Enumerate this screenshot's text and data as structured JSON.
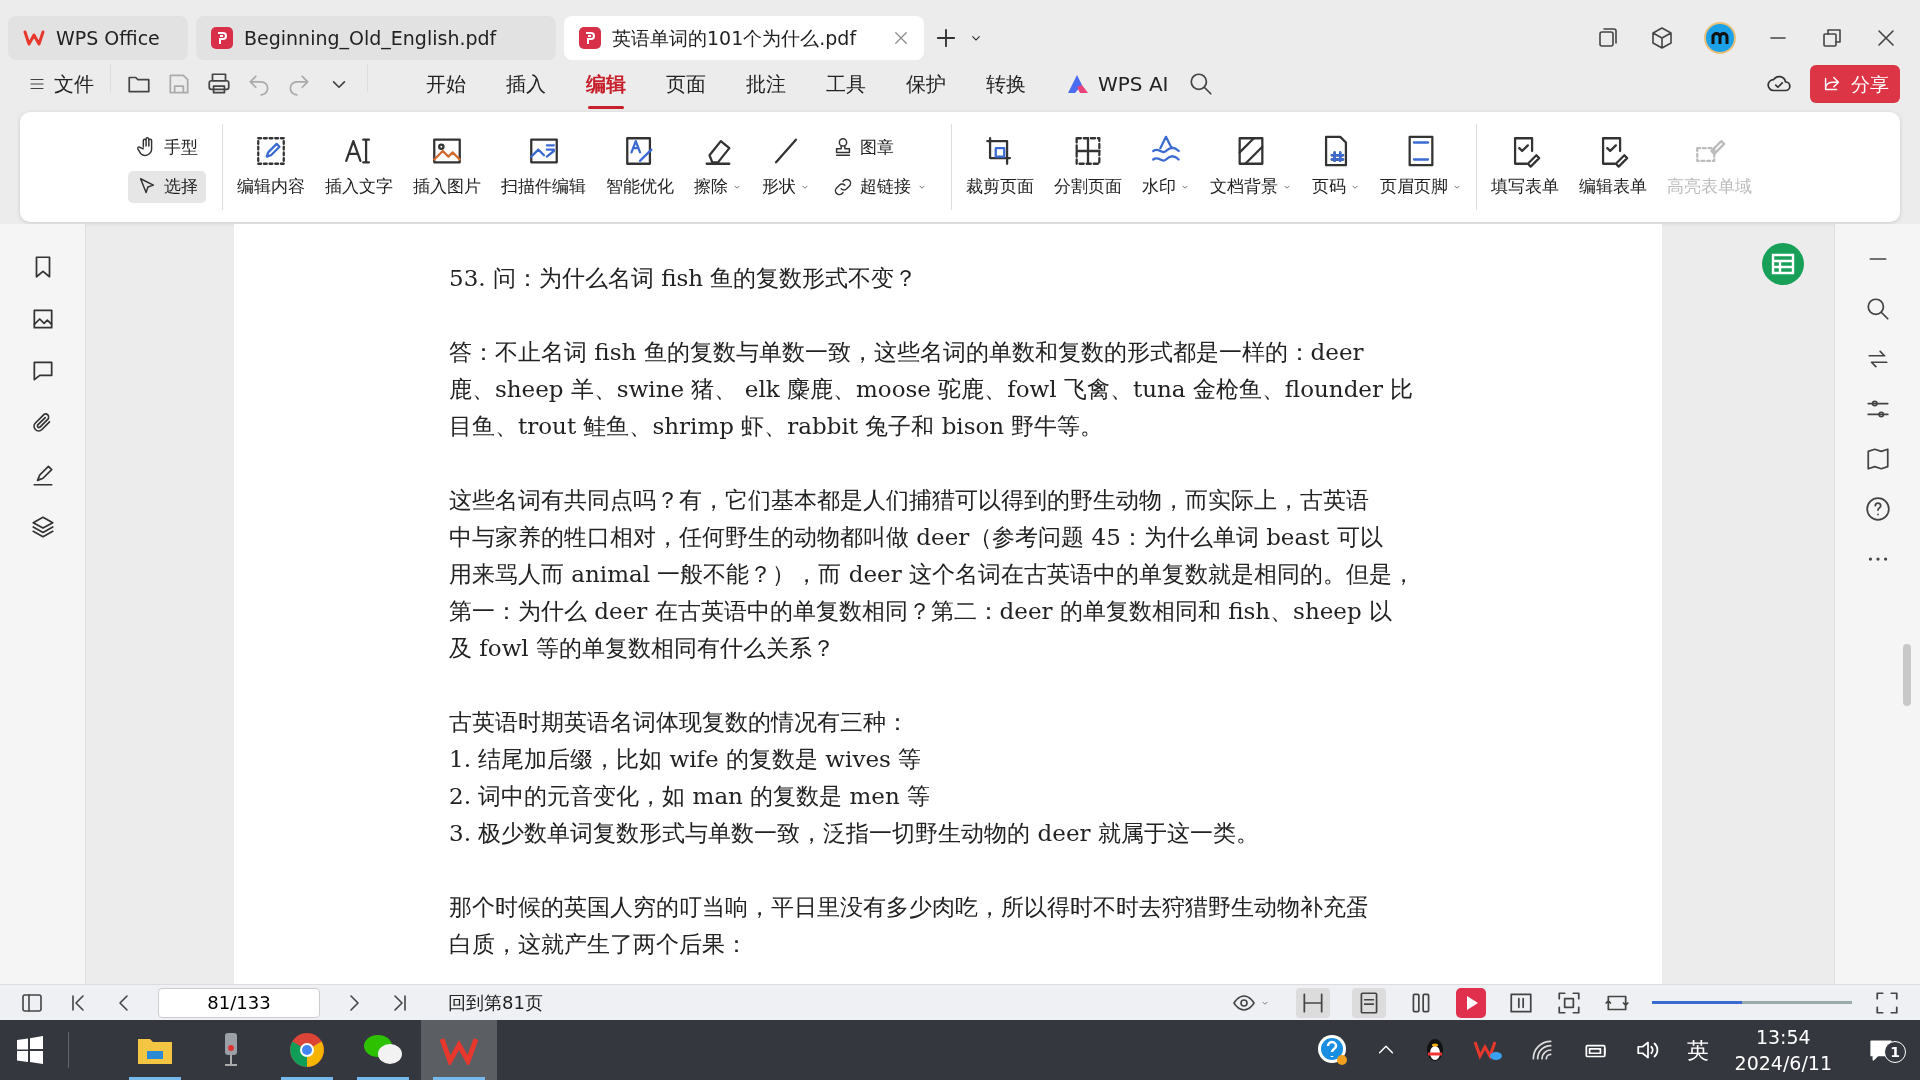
{
  "tabs": [
    {
      "label": "WPS Office",
      "kind": "home",
      "selected": false
    },
    {
      "label": "Beginning_Old_English.pdf",
      "kind": "pdf",
      "selected": false
    },
    {
      "label": "英语单词的101个为什么.pdf",
      "kind": "pdf",
      "selected": true
    }
  ],
  "menu": {
    "file": "文件",
    "items": [
      {
        "label": "开始",
        "selected": false
      },
      {
        "label": "插入",
        "selected": false
      },
      {
        "label": "编辑",
        "selected": true
      },
      {
        "label": "页面",
        "selected": false
      },
      {
        "label": "批注",
        "selected": false
      },
      {
        "label": "工具",
        "selected": false
      },
      {
        "label": "保护",
        "selected": false
      },
      {
        "label": "转换",
        "selected": false
      }
    ],
    "ai": "WPS AI",
    "share": "分享"
  },
  "ribbon": {
    "mode_tools": [
      {
        "label": "手型",
        "selected": false
      },
      {
        "label": "选择",
        "selected": true
      }
    ],
    "edit_tools": [
      {
        "label": "编辑内容",
        "dropdown": false
      },
      {
        "label": "插入文字",
        "dropdown": false
      },
      {
        "label": "插入图片",
        "dropdown": false
      },
      {
        "label": "扫描件编辑",
        "dropdown": false
      },
      {
        "label": "智能优化",
        "dropdown": false
      },
      {
        "label": "擦除",
        "dropdown": true
      },
      {
        "label": "形状",
        "dropdown": true
      }
    ],
    "link_tools": [
      {
        "label": "图章",
        "dropdown": false
      },
      {
        "label": "超链接",
        "dropdown": true
      }
    ],
    "page_tools": [
      {
        "label": "裁剪页面",
        "dropdown": false
      },
      {
        "label": "分割页面",
        "dropdown": false
      },
      {
        "label": "水印",
        "dropdown": true
      },
      {
        "label": "文档背景",
        "dropdown": true
      },
      {
        "label": "页码",
        "dropdown": true
      },
      {
        "label": "页眉页脚",
        "dropdown": true
      }
    ],
    "form_tools": [
      {
        "label": "填写表单",
        "disabled": false
      },
      {
        "label": "编辑表单",
        "disabled": false
      },
      {
        "label": "高亮表单域",
        "disabled": true
      }
    ]
  },
  "document": {
    "paragraphs": [
      [
        "53.  问：为什么名词 fish 鱼的复数形式不变？"
      ],
      [
        "答：不止名词 fish 鱼的复数与单数一致，这些名词的单数和复数的形式都是一样的：deer",
        "鹿、sheep 羊、swine 猪、 elk 麋鹿、moose 驼鹿、fowl 飞禽、tuna 金枪鱼、flounder 比",
        "目鱼、trout 鲑鱼、shrimp 虾、rabbit 兔子和 bison 野牛等。"
      ],
      [
        "这些名词有共同点吗？有，它们基本都是人们捕猎可以得到的野生动物，而实际上，古英语",
        "中与家养的牲口相对，任何野生的动物都叫做 deer（参考问题 45：为什么单词 beast 可以",
        "用来骂人而 animal 一般不能？），而 deer 这个名词在古英语中的单复数就是相同的。但是，",
        "第一：为什么 deer 在古英语中的单复数相同？第二：deer 的单复数相同和 fish、sheep 以",
        "及 fowl 等的单复数相同有什么关系？"
      ],
      [
        "古英语时期英语名词体现复数的情况有三种：",
        "1.  结尾加后缀，比如 wife 的复数是 wives 等",
        "2.  词中的元音变化，如 man 的复数是 men 等",
        "3.  极少数单词复数形式与单数一致，泛指一切野生动物的 deer 就属于这一类。"
      ],
      [
        "那个时候的英国人穷的叮当响，平日里没有多少肉吃，所以得时不时去狩猎野生动物补充蛋",
        "白质，这就产生了两个后果："
      ]
    ]
  },
  "status_bar": {
    "page_field": "81/133",
    "goto": "回到第81页",
    "zoom_slider": {
      "level": 0.45
    }
  },
  "taskbar": {
    "apps": [
      {
        "kind": "explorer",
        "open": true,
        "active": false
      },
      {
        "kind": "mic",
        "open": false,
        "active": false
      },
      {
        "kind": "chrome",
        "open": true,
        "active": false
      },
      {
        "kind": "wechat",
        "open": true,
        "active": false
      },
      {
        "kind": "wps",
        "open": true,
        "active": true
      }
    ],
    "ime": "英",
    "time": "13:54",
    "date": "2024/6/11",
    "notifications": "1"
  }
}
